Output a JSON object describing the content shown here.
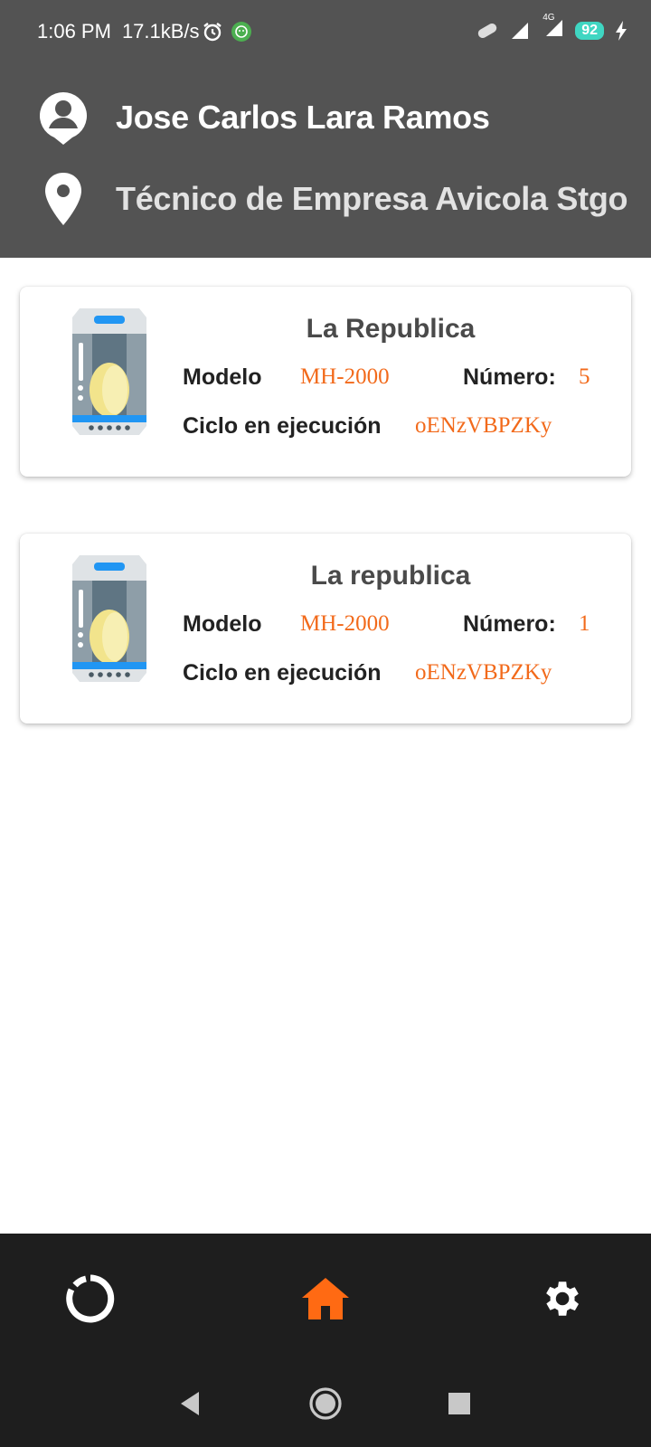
{
  "status_bar": {
    "time": "1:06 PM",
    "speed": "17.1kB/s",
    "network": "4G",
    "battery": "92"
  },
  "header": {
    "user_name": "Jose Carlos Lara Ramos",
    "role": "Técnico de Empresa Avicola Stgo",
    "icons": {
      "user": "account-circle-icon",
      "location": "map-pin-icon"
    }
  },
  "cards": [
    {
      "title": "La Republica",
      "modelo_label": "Modelo",
      "modelo": "MH-2000",
      "numero_label": "Número:",
      "numero": "5",
      "ciclo_label": "Ciclo en ejecución",
      "ciclo": "oENzVBPZKy"
    },
    {
      "title": "La republica",
      "modelo_label": "Modelo",
      "modelo": "MH-2000",
      "numero_label": "Número:",
      "numero": "1",
      "ciclo_label": "Ciclo en ejecución",
      "ciclo": "oENzVBPZKy"
    }
  ],
  "bottom_nav": {
    "items": [
      {
        "icon": "refresh-ring-icon",
        "active": false
      },
      {
        "icon": "home-icon",
        "active": true
      },
      {
        "icon": "gear-icon",
        "active": false
      }
    ],
    "active_color": "#FF6A13"
  },
  "colors": {
    "header_bg": "#535353",
    "accent": "#F26A1B",
    "nav_bg": "#1E1E1E"
  }
}
